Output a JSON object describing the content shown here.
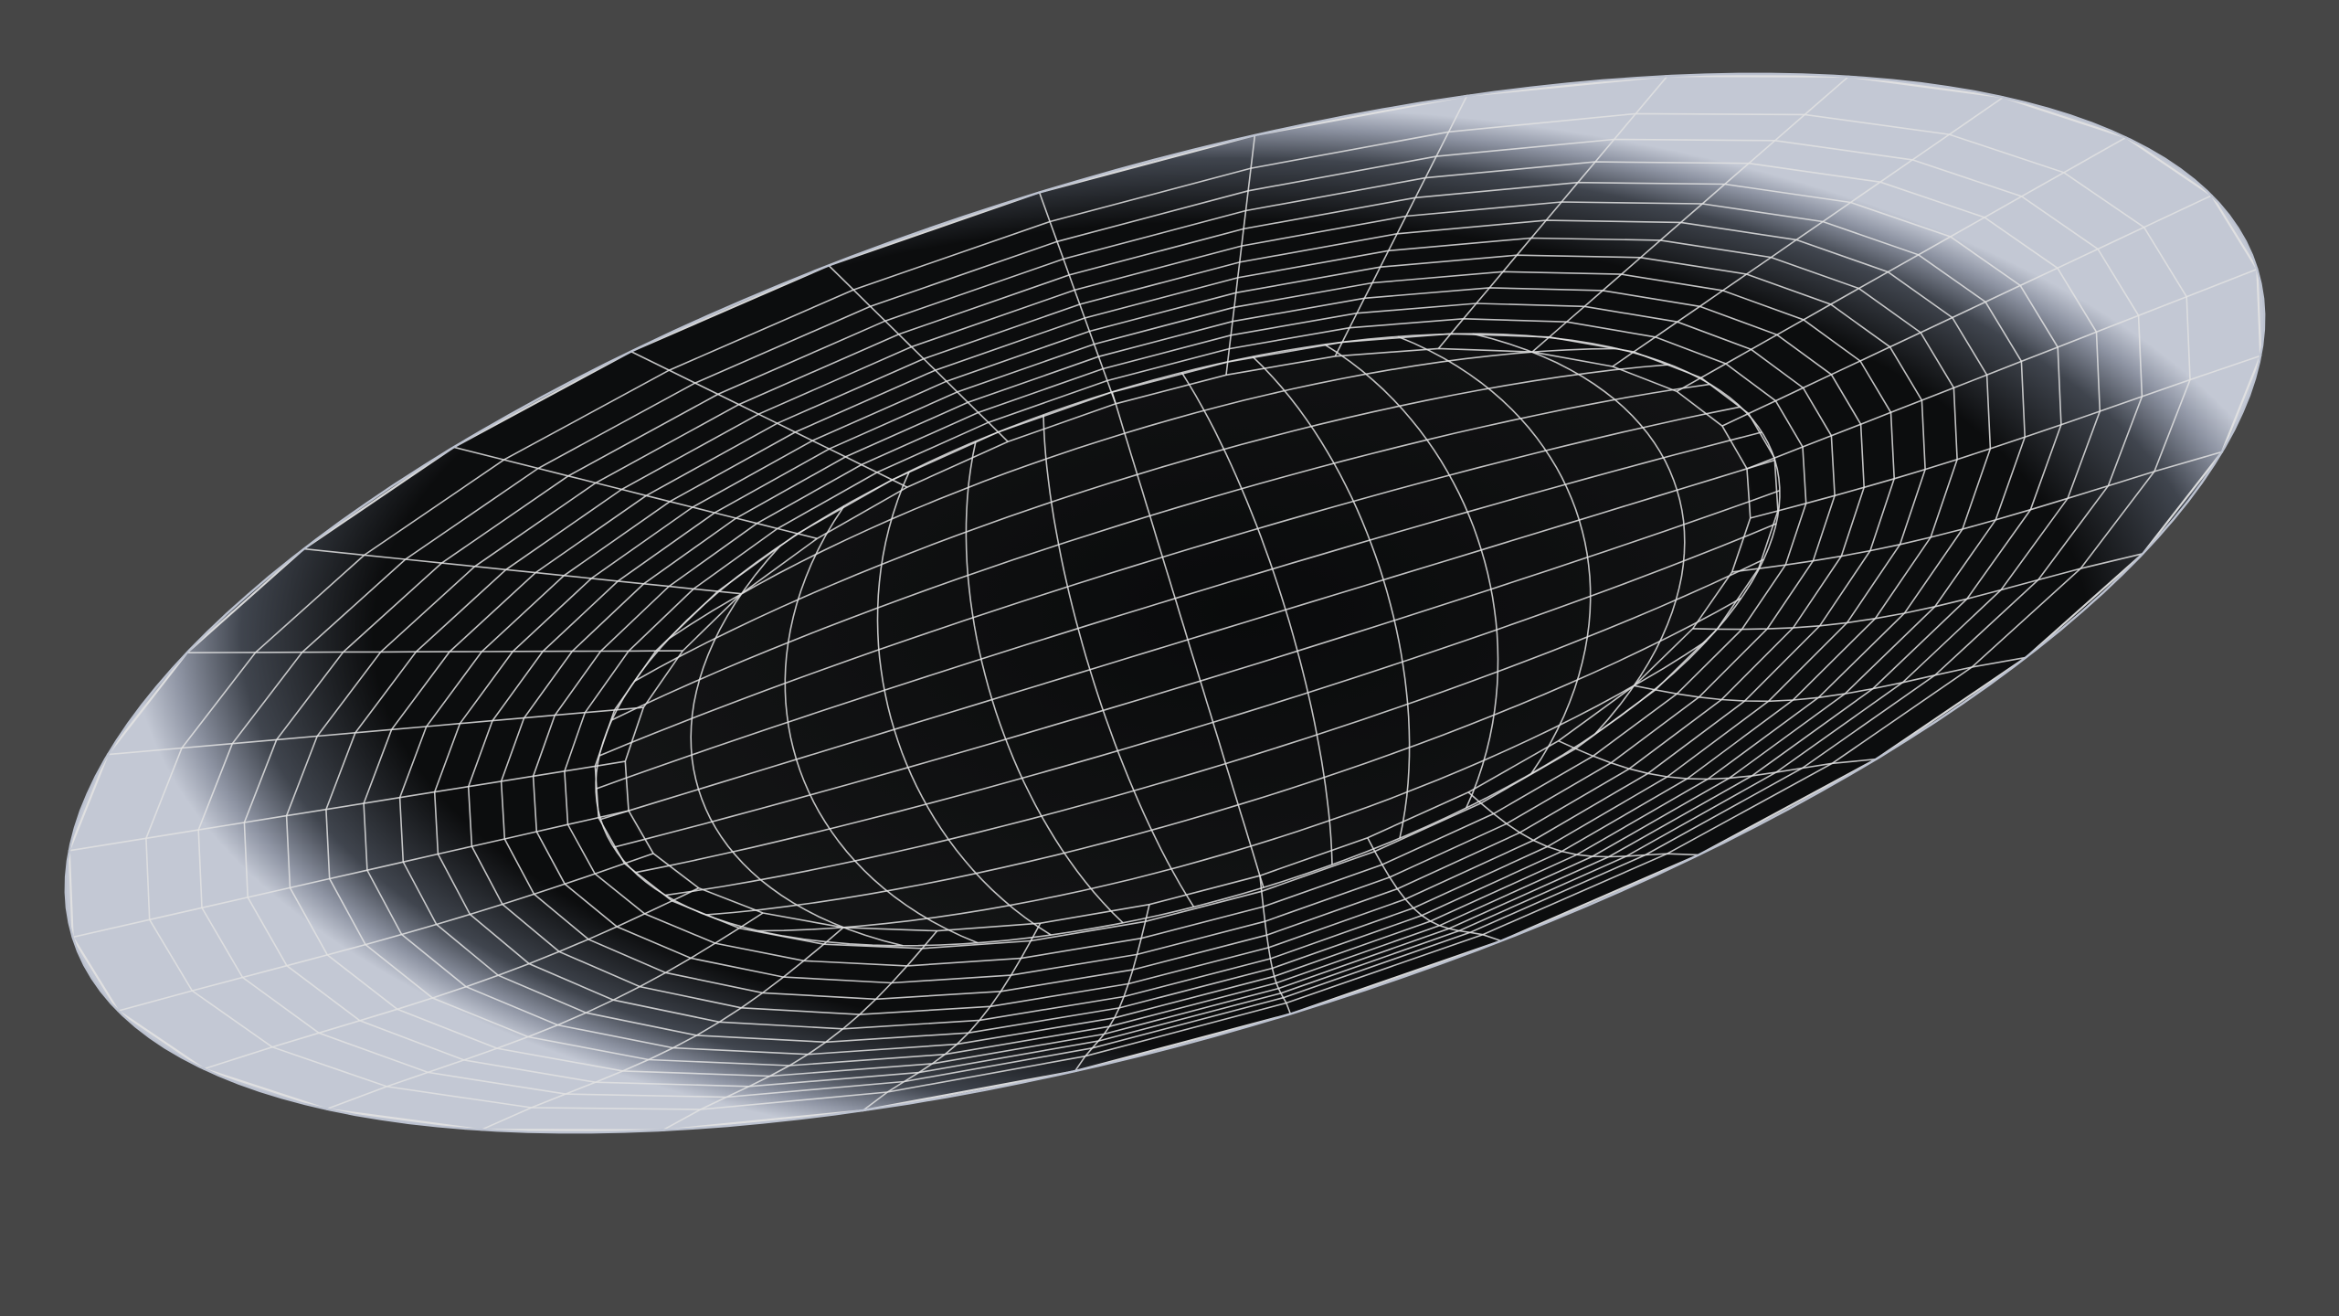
{
  "scene": {
    "background_color": "#464646",
    "object": "dish-mesh",
    "interior_color": "#0c0d0e",
    "rim_color": "#bcc2d0",
    "wire_color": "#e2e2e2",
    "radial_segments": 32,
    "rings": 14,
    "grid_lines": 13,
    "view": "perspective"
  }
}
